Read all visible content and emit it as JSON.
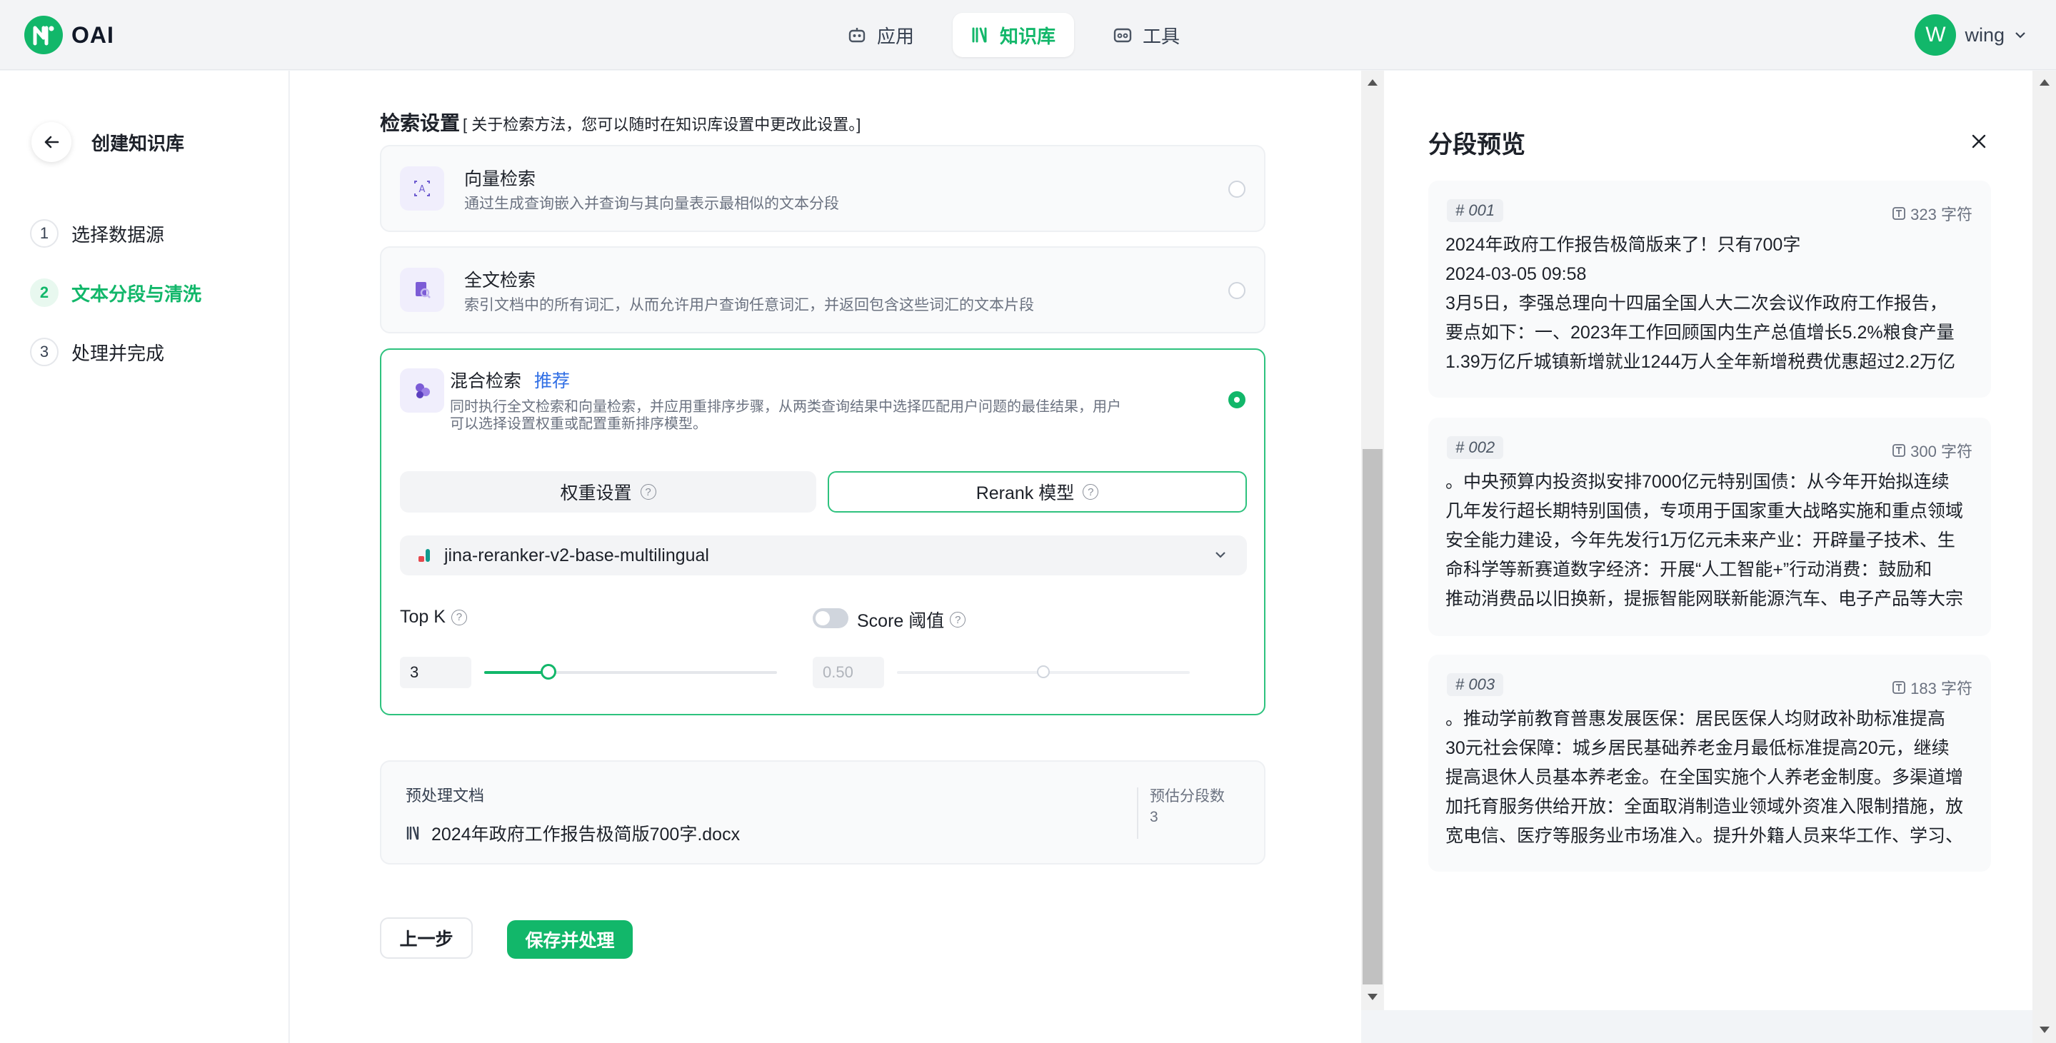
{
  "header": {
    "logo_text": "OAI",
    "nav": [
      {
        "label": "应用",
        "icon": "robot-icon"
      },
      {
        "label": "知识库",
        "icon": "book-icon"
      },
      {
        "label": "工具",
        "icon": "toolbox-icon"
      }
    ],
    "user": {
      "avatar_letter": "W",
      "name": "wing"
    }
  },
  "sidebar": {
    "title": "创建知识库",
    "steps": [
      {
        "num": "1",
        "label": "选择数据源"
      },
      {
        "num": "2",
        "label": "文本分段与清洗"
      },
      {
        "num": "3",
        "label": "处理并完成"
      }
    ]
  },
  "retrieval": {
    "title": "检索设置",
    "subtitle": "[ 关于检索方法，您可以随时在知识库设置中更改此设置。]",
    "vector": {
      "name": "向量检索",
      "desc": "通过生成查询嵌入并查询与其向量表示最相似的文本分段"
    },
    "fulltext": {
      "name": "全文检索",
      "desc": "索引文档中的所有词汇，从而允许用户查询任意词汇，并返回包含这些词汇的文本片段"
    },
    "hybrid": {
      "name": "混合检索",
      "tag": "推荐",
      "desc_line1": "同时执行全文检索和向量检索，并应用重排序步骤，从两类查询结果中选择匹配用户问题的最佳结果，用户",
      "desc_line2": "可以选择设置权重或配置重新排序模型。",
      "tabs": [
        "权重设置",
        "Rerank 模型"
      ],
      "model": "jina-reranker-v2-base-multilingual",
      "topk_label": "Top K",
      "topk_value": "3",
      "topk_fraction": 0.22,
      "score_label": "Score 阈值",
      "score_value": "0.50",
      "score_fraction": 0.5
    }
  },
  "doc": {
    "header": "预处理文档",
    "file": "2024年政府工作报告极简版700字.docx",
    "est_label": "预估分段数",
    "est_value": "3"
  },
  "buttons": {
    "prev": "上一步",
    "save": "保存并处理"
  },
  "preview": {
    "title": "分段预览",
    "cards": [
      {
        "id": "# 001",
        "chars": "323 字符",
        "lines": [
          "2024年政府工作报告极简版来了！只有700字",
          "2024-03-05 09:58",
          "3月5日，李强总理向十四届全国人大二次会议作政府工作报告，",
          "要点如下：一、2023年工作回顾国内生产总值增长5.2%粮食产量",
          "1.39万亿斤城镇新增就业1244万人全年新增税费优惠超过2.2万亿"
        ]
      },
      {
        "id": "# 002",
        "chars": "300 字符",
        "lines": [
          "。中央预算内投资拟安排7000亿元特别国债：从今年开始拟连续",
          "几年发行超长期特别国债，专项用于国家重大战略实施和重点领域",
          "安全能力建设，今年先发行1万亿元未来产业：开辟量子技术、生",
          "命科学等新赛道数字经济：开展“人工智能+”行动消费：鼓励和",
          "推动消费品以旧换新，提振智能网联新能源汽车、电子产品等大宗"
        ]
      },
      {
        "id": "# 003",
        "chars": "183 字符",
        "lines": [
          "。推动学前教育普惠发展医保：居民医保人均财政补助标准提高",
          "30元社会保障：城乡居民基础养老金月最低标准提高20元，继续",
          "提高退休人员基本养老金。在全国实施个人养老金制度。多渠道增",
          "加托育服务供给开放：全面取消制造业领域外资准入限制措施，放",
          "宽电信、医疗等服务业市场准入。提升外籍人员来华工作、学习、"
        ]
      }
    ]
  },
  "colors": {
    "accent": "#12b76a",
    "recommend": "#2f6ee5"
  }
}
